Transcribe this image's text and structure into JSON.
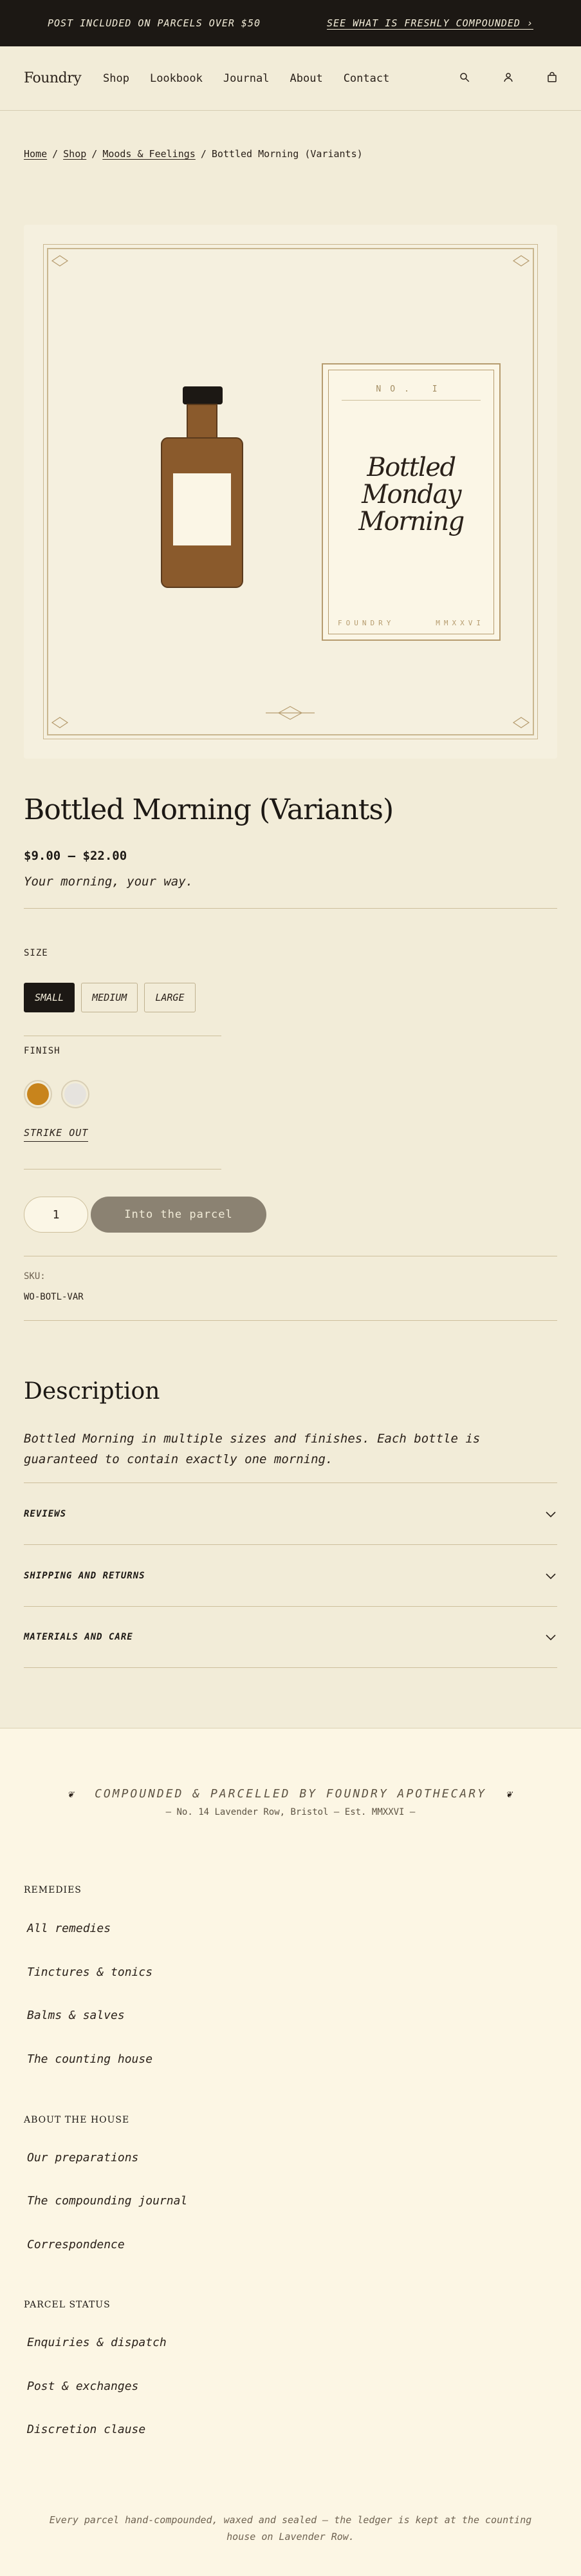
{
  "announcement": {
    "left": "POST INCLUDED ON PARCELS OVER $50",
    "right": "SEE WHAT IS FRESHLY COMPOUNDED ›"
  },
  "header": {
    "logo": "Foundry",
    "nav": [
      "Shop",
      "Lookbook",
      "Journal",
      "About",
      "Contact"
    ],
    "icons": [
      "search-icon",
      "account-icon",
      "bag-icon"
    ]
  },
  "breadcrumb": {
    "items": [
      "Home",
      "Shop",
      "Moods & Feelings"
    ],
    "current": "Bottled Morning (Variants)"
  },
  "hero": {
    "card_no": "NO. I",
    "card_title_lines": [
      "Bottled",
      "Monday",
      "Morning"
    ],
    "card_foot_left": "FOUNDRY",
    "card_foot_right": "MMXXVI"
  },
  "product": {
    "title": "Bottled Morning (Variants)",
    "price": "$9.00 – $22.00",
    "tagline": "Your morning, your way.",
    "size_label": "SIZE",
    "sizes": [
      "SMALL",
      "MEDIUM",
      "LARGE"
    ],
    "selected_size": "SMALL",
    "finish_label": "FINISH",
    "finish_colors": [
      "#c8841c",
      "#e6e3de"
    ],
    "strike_out": "STRIKE OUT",
    "quantity": "1",
    "add_button": "Into the parcel",
    "sku_label": "SKU:",
    "sku": "WO-BOTL-VAR"
  },
  "description": {
    "title": "Description",
    "text": "Bottled Morning in multiple sizes and finishes. Each bottle is guaranteed to contain exactly one morning."
  },
  "accordion": [
    "REVIEWS",
    "SHIPPING AND RETURNS",
    "MATERIALS AND CARE"
  ],
  "footer": {
    "heading": "COMPOUNDED & PARCELLED BY FOUNDRY APOTHECARY",
    "subheading": "— No. 14 Lavender Row, Bristol — Est. MMXXVI —",
    "columns": [
      {
        "title": "REMEDIES",
        "links": [
          "All remedies",
          "Tinctures & tonics",
          "Balms & salves",
          "The counting house"
        ]
      },
      {
        "title": "ABOUT THE HOUSE",
        "links": [
          "Our preparations",
          "The compounding journal",
          "Correspondence"
        ]
      },
      {
        "title": "PARCEL STATUS",
        "links": [
          "Enquiries & dispatch",
          "Post & exchanges",
          "Discretion clause"
        ]
      }
    ],
    "note": "Every parcel hand-compounded, waxed and sealed — the ledger is kept at the counting house on Lavender Row."
  },
  "colors": {
    "dark": "#1c1814",
    "background": "#f2ecd8",
    "bottle": "#8a5a2c",
    "button": "#8b8272"
  }
}
